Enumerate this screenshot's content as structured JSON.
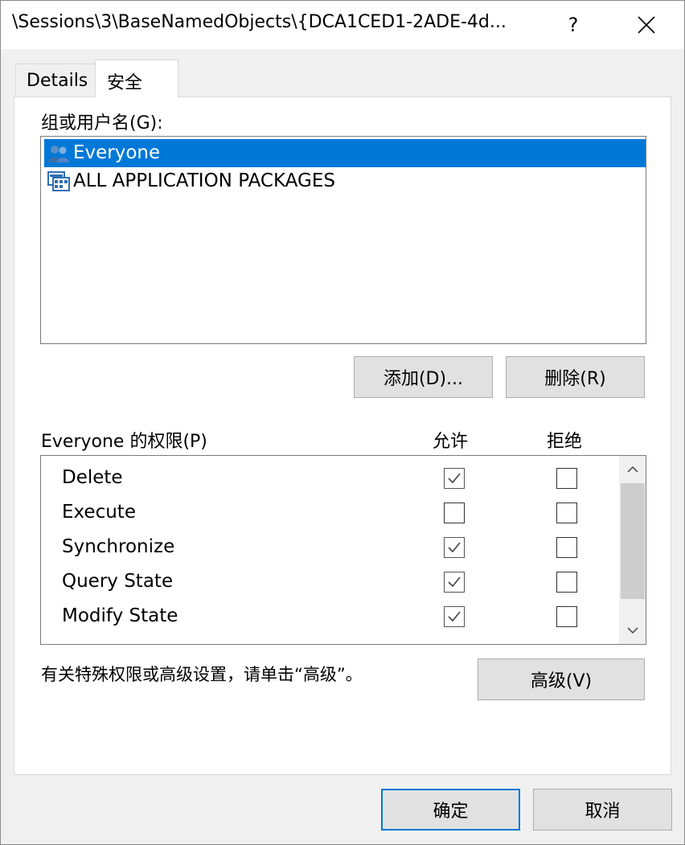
{
  "window": {
    "title": "\\Sessions\\3\\BaseNamedObjects\\{DCA1CED1-2ADE-4d...",
    "help_label": "?",
    "close_icon": "close-icon"
  },
  "tabs": [
    {
      "label": "Details",
      "active": false
    },
    {
      "label": "安全",
      "active": true
    }
  ],
  "groups": {
    "label": "组或用户名(G):",
    "items": [
      {
        "name": "Everyone",
        "icon": "users-icon",
        "selected": true
      },
      {
        "name": "ALL APPLICATION PACKAGES",
        "icon": "app-packages-icon",
        "selected": false
      }
    ],
    "add_label": "添加(D)...",
    "remove_label": "删除(R)"
  },
  "permissions": {
    "label": "Everyone 的权限(P)",
    "allow_header": "允许",
    "deny_header": "拒绝",
    "rows": [
      {
        "name": "Delete",
        "allow": true,
        "deny": false
      },
      {
        "name": "Execute",
        "allow": false,
        "deny": false
      },
      {
        "name": "Synchronize",
        "allow": true,
        "deny": false
      },
      {
        "name": "Query State",
        "allow": true,
        "deny": false
      },
      {
        "name": "Modify State",
        "allow": true,
        "deny": false
      }
    ]
  },
  "advanced": {
    "hint": "有关特殊权限或高级设置，请单击“高级”。",
    "button_label": "高级(V)"
  },
  "footer": {
    "ok_label": "确定",
    "cancel_label": "取消"
  },
  "colors": {
    "selection": "#0078d7",
    "button_face": "#e1e1e1",
    "default_border": "#0078d7"
  }
}
